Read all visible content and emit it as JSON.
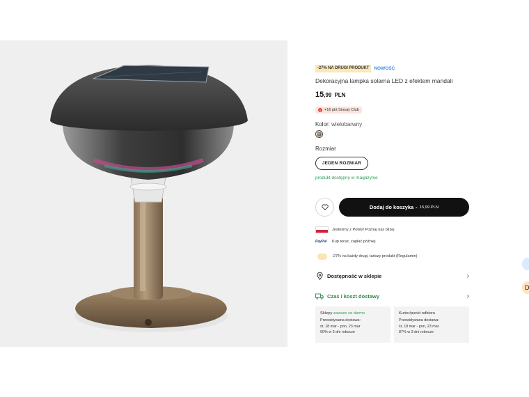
{
  "product": {
    "promo_badge": "-27% NA DRUGI PRODUKT",
    "new_badge": "NOWOŚĆ",
    "title": "Dekoracyjna lampka solarna LED z efektem mandali",
    "price_int": "15",
    "price_dec": ",99",
    "currency": "PLN",
    "club_text": "+16 pkt Sinsay Club",
    "club_icon": "S",
    "color_label": "Kolor:",
    "color_value": "wielobarwny",
    "size_label": "Rozmiar",
    "size_option": "JEDEN ROZMIAR",
    "stock_status": "produkt dostępny w magazynie",
    "add_to_cart": "Dodaj do koszyka",
    "cart_separator": "-",
    "cart_price": "15,99 PLN"
  },
  "info_rows": [
    {
      "text": "Jesteśmy z Polski! Poznaj nas bliżej",
      "icon": "polish-flag"
    },
    {
      "text": "Kup teraz, zapłać później",
      "icon": "paypal-logo",
      "logo_text": "PayPal"
    },
    {
      "text": "-27% na każdy drugi, tańszy produkt (Regulamin)",
      "icon": "promo-icon"
    }
  ],
  "accordions": [
    {
      "label": "Dostępność w sklepie",
      "icon": "location-pin-icon"
    },
    {
      "label": "Czas i koszt dostawy",
      "icon": "truck-icon"
    }
  ],
  "delivery": [
    {
      "heading": "Sklepy",
      "free": "zawsze za darmo",
      "est_label": "Przewidywana dostawa:",
      "dates": "śr, 18 mar - pon, 23 mar",
      "rate": "90% w 3 dni robocze"
    },
    {
      "heading": "Kurier/punkt odbioru",
      "free": "",
      "est_label": "Przewidywana dostawa:",
      "dates": "śr, 18 mar - pon, 23 mar",
      "rate": "87% w 3 dni robocze"
    }
  ],
  "edge_partial": {
    "text": "D"
  },
  "colors": {
    "cart_button": "#111111",
    "in_stock_green": "#2ea05a",
    "new_badge_blue": "#3b8ee8",
    "promo_badge_bg": "#fbe7b8",
    "club_bg": "#fde3dd"
  }
}
